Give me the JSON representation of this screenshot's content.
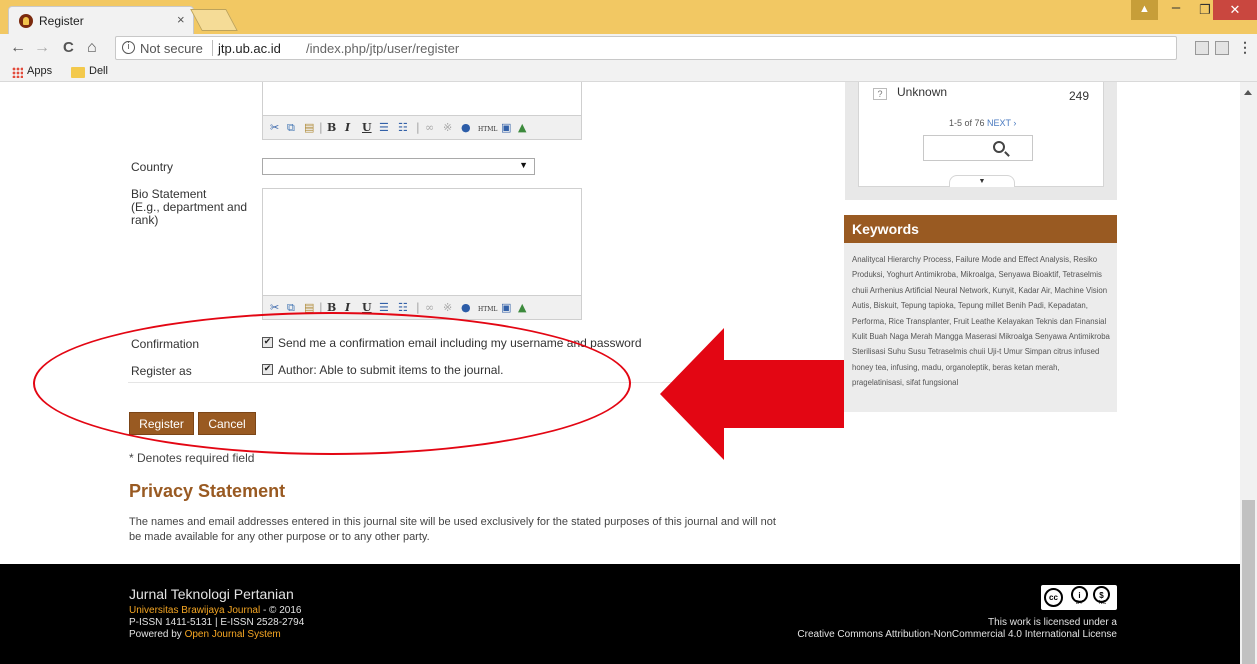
{
  "browser": {
    "tab_title": "Register",
    "tab_close": "×",
    "not_secure": "Not secure",
    "url_host": "jtp.ub.ac.id",
    "url_path": "/index.php/jtp/user/register",
    "bookmarks": [
      "Apps",
      "Dell"
    ],
    "nav": {
      "back": "←",
      "forward": "→",
      "reload": "C",
      "home": "⌂"
    },
    "window": {
      "user": "▲",
      "minimize": "–",
      "maximize": "❐",
      "close": "✕"
    },
    "menu": "⋮",
    "star": "☆"
  },
  "editor_toolbar": {
    "buttons": [
      "cut-icon",
      "copy-icon",
      "paste-icon",
      "bold-icon",
      "italic-icon",
      "underline-icon",
      "bullet-list-icon",
      "numbered-list-icon",
      "link-icon",
      "unlink-icon",
      "help-icon",
      "html-icon",
      "fullscreen-icon",
      "image-icon"
    ]
  },
  "form": {
    "country_label": "Country",
    "country_value": "",
    "bio_label_1": "Bio Statement",
    "bio_label_2": "(E.g., department and",
    "bio_label_3": "rank)",
    "confirmation_label": "Confirmation",
    "confirmation_text": "Send me a confirmation email including my username and password",
    "confirmation_checked": true,
    "register_as_label": "Register as",
    "register_as_text": "Author: Able to submit items to the journal.",
    "register_as_checked": true,
    "register_button": "Register",
    "cancel_button": "Cancel",
    "required_note": "* Denotes required field"
  },
  "privacy": {
    "title": "Privacy Statement",
    "text": "The names and email addresses entered in this journal site will be used exclusively for the stated purposes of this journal and will not be made available for any other purpose or to any other party."
  },
  "sidebar": {
    "unknown_label": "Unknown",
    "unknown_count": "249",
    "pager_text": "1-5 of 76",
    "pager_next": "NEXT ›",
    "keywords_title": "Keywords",
    "keywords_text": "Analitycal Hierarchy Process, Failure Mode and Effect Analysis, Resiko Produksi, Yoghurt Antimikroba, Mikroalga, Senyawa Bioaktif, Tetraselmis chuii Arrhenius Artificial Neural Network, Kunyit, Kadar Air, Machine Vision Autis, Biskuit, Tepung tapioka, Tepung millet Benih Padi, Kepadatan, Performa, Rice Transplanter, Fruit Leathe Kelayakan Teknis dan Finansial Kulit Buah Naga Merah Mangga Maserasi Mikroalga Senyawa Antimikroba Sterilisasi Suhu Susu Tetraselmis chuii Uji-t Umur Simpan citrus infused honey tea, infusing, madu, organoleptik, beras ketan merah, pragelatinisasi, sifat fungsional"
  },
  "footer": {
    "title": "Jurnal Teknologi Pertanian",
    "line1_link": "Universitas Brawijaya Journal",
    "line1_rest": " - © 2016",
    "line2": "P-ISSN 1411-5131 | E-ISSN 2528-2794",
    "line3_prefix": "Powered by ",
    "line3_link": "Open Journal System",
    "license_text": "This work is licensed under a",
    "license_link": "Creative Commons Attribution-NonCommercial 4.0 International License",
    "cc_by": "BY",
    "cc_nc": "NC"
  },
  "colors": {
    "accent": "#995a22",
    "annotation": "#e30613",
    "tab_strip": "#f2c863",
    "footer_link": "#f5a623"
  }
}
